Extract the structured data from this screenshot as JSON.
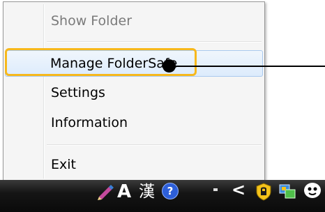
{
  "menu": {
    "items": [
      {
        "label": "Show Folder",
        "enabled": false
      },
      {
        "label": "Manage FolderSafe",
        "enabled": true,
        "highlighted": true
      },
      {
        "label": "Settings",
        "enabled": true
      },
      {
        "label": "Information",
        "enabled": true
      },
      {
        "label": "Exit",
        "enabled": true
      }
    ]
  },
  "taskbar": {
    "ime_mode": "A",
    "ime_hanja": "漢",
    "help_glyph": "?",
    "overflow_glyph": "<",
    "tray_icons": [
      "pencil-icon",
      "ime-a-icon",
      "hanja-icon",
      "help-icon",
      "minimize-dash-icon",
      "show-hidden-icons-chevron",
      "foldersafe-tray-icon",
      "network-icon",
      "messenger-icon"
    ]
  },
  "colors": {
    "annotation": "#f7b81c",
    "hover_border": "#a9c9ee",
    "help_blue": "#2d5fd9"
  }
}
